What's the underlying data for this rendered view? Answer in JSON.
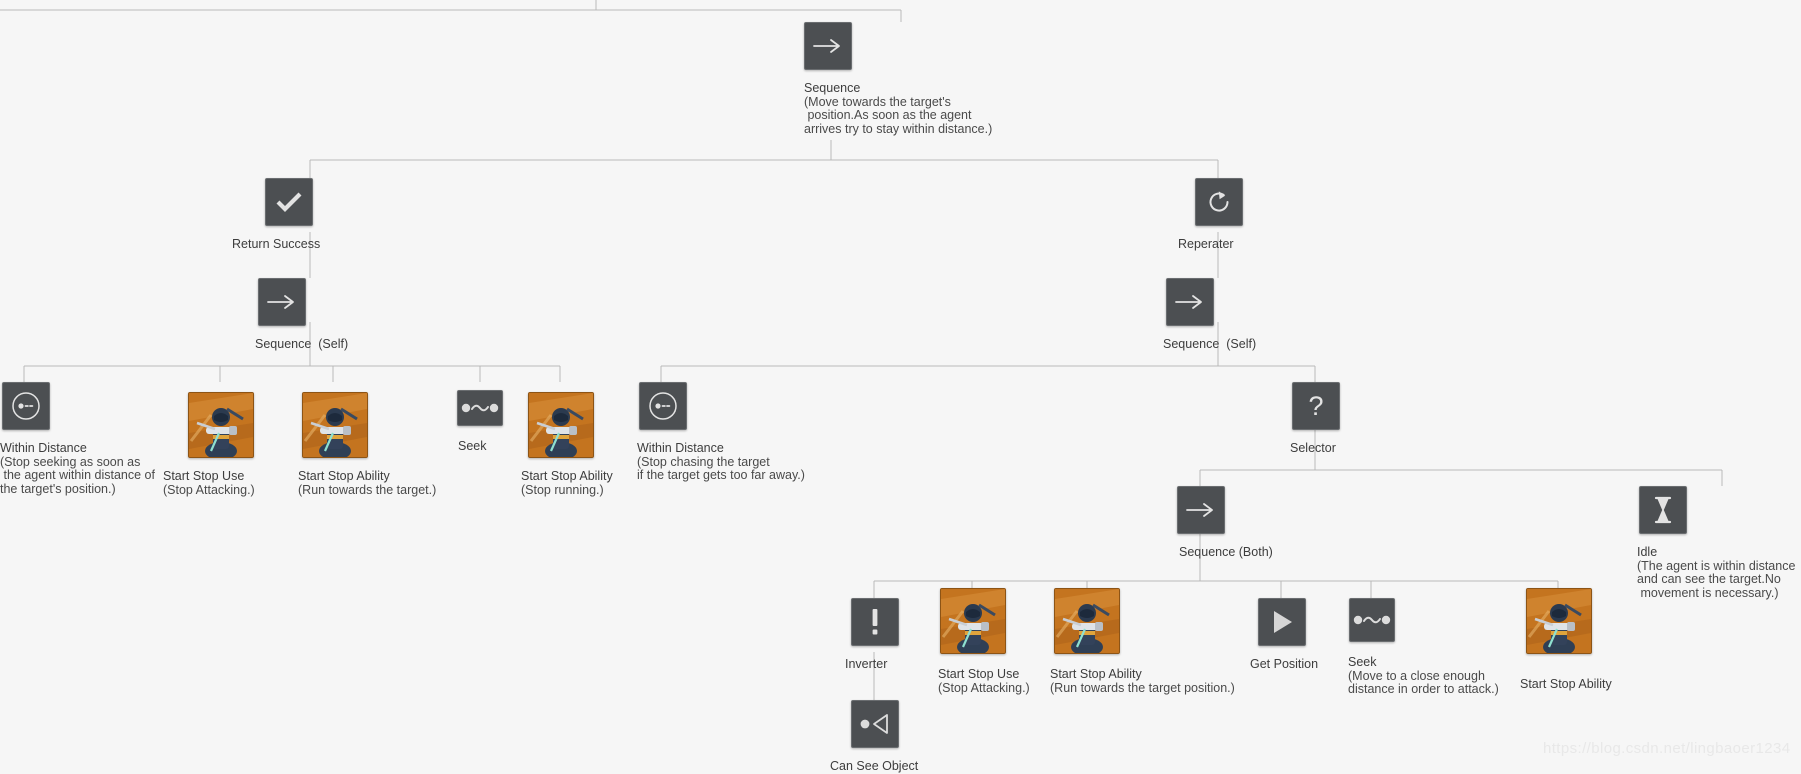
{
  "diagram": {
    "kind": "behavior-tree",
    "background_color": "#f6f6f6",
    "edge_color": "#b9b9b9",
    "node_box_color": "#4c4f52",
    "task_icon_color": "#c4741f",
    "watermark": "https://blog.csdn.net/lingbaoer1234"
  },
  "nodes": {
    "root_sequence": {
      "label": "Sequence",
      "desc": "(Move towards the target's\n position.As soon as the agent\narrives try to stay within distance.)",
      "icon": "arrow-right-icon"
    },
    "return_success": {
      "label": "Return Success",
      "desc": "",
      "icon": "check-icon"
    },
    "repeater": {
      "label": "Reperater",
      "desc": "",
      "icon": "refresh-loop-icon"
    },
    "sequence_self_left": {
      "label": "Sequence  (Self)",
      "desc": "",
      "icon": "arrow-right-icon"
    },
    "sequence_self_right": {
      "label": "Sequence  (Self)",
      "desc": "",
      "icon": "arrow-right-icon"
    },
    "within_distance_left": {
      "label": "Within Distance",
      "desc": "(Stop seeking as soon as\n the agent within distance of\nthe target's position.)",
      "icon": "within-distance-icon"
    },
    "start_stop_use_left": {
      "label": "Start Stop Use",
      "desc": "(Stop Attacking.)",
      "icon": "character-task-icon"
    },
    "start_stop_ability_left": {
      "label": "Start Stop Ability",
      "desc": "(Run towards the target.)",
      "icon": "character-task-icon"
    },
    "seek_left": {
      "label": "Seek",
      "desc": "",
      "icon": "seek-icon"
    },
    "start_stop_ability_stop_running": {
      "label": "Start Stop Ability",
      "desc": "(Stop running.)",
      "icon": "character-task-icon"
    },
    "within_distance_right": {
      "label": "Within Distance",
      "desc": "(Stop chasing the target\nif the target gets too far away.)",
      "icon": "within-distance-icon"
    },
    "selector": {
      "label": "Selector",
      "desc": "",
      "icon": "question-mark-icon"
    },
    "sequence_both": {
      "label": "Sequence (Both)",
      "desc": "",
      "icon": "arrow-right-icon"
    },
    "idle": {
      "label": "Idle",
      "desc": "(The agent is within distance\nand can see the target.No\n movement is necessary.)",
      "icon": "hourglass-icon"
    },
    "inverter": {
      "label": "Inverter",
      "desc": "",
      "icon": "exclamation-icon"
    },
    "can_see_object": {
      "label": "Can See Object",
      "desc": "",
      "icon": "vision-cone-icon"
    },
    "start_stop_use_bottom": {
      "label": "Start Stop Use",
      "desc": "(Stop Attacking.)",
      "icon": "character-task-icon"
    },
    "start_stop_ability_bottom": {
      "label": "Start Stop Ability",
      "desc": "(Run towards the target position.)",
      "icon": "character-task-icon"
    },
    "get_position": {
      "label": "Get Position",
      "desc": "",
      "icon": "play-triangle-icon"
    },
    "seek_bottom": {
      "label": "Seek",
      "desc": "(Move to a close enough\ndistance in order to attack.)",
      "icon": "seek-icon"
    },
    "start_stop_ability_far_right": {
      "label": "Start Stop Ability",
      "desc": "",
      "icon": "character-task-icon"
    }
  }
}
